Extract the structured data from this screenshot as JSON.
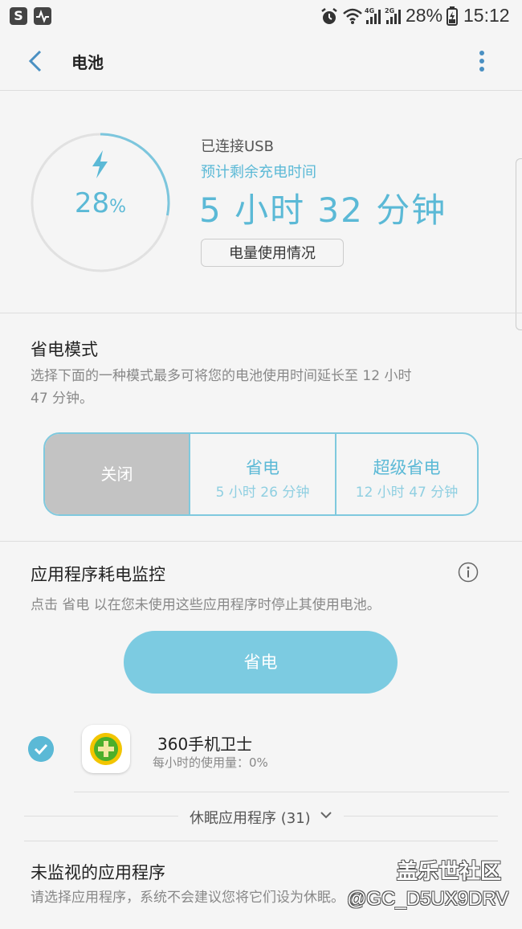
{
  "status_bar": {
    "signal_labels": [
      "4G",
      "2G"
    ],
    "battery": "28%",
    "time": "15:12"
  },
  "appbar": {
    "title": "电池"
  },
  "battery": {
    "percent": "28",
    "percent_unit": "%",
    "charge_level": 0.28,
    "usb_status": "已连接USB",
    "remaining_label": "预计剩余充电时间",
    "remaining_time": "5 小时 32 分钟",
    "usage_button": "电量使用情况"
  },
  "power_saving": {
    "title": "省电模式",
    "description": "选择下面的一种模式最多可将您的电池使用时间延长至 12 小时 47 分钟。",
    "modes": [
      {
        "label": "关闭",
        "sub": ""
      },
      {
        "label": "省电",
        "sub": "5 小时 26 分钟"
      },
      {
        "label": "超级省电",
        "sub": "12 小时 47 分钟"
      }
    ],
    "selected": "关闭"
  },
  "app_monitor": {
    "title": "应用程序耗电监控",
    "description": "点击 省电 以在您未使用这些应用程序时停止其使用电池。",
    "save_button": "省电",
    "apps": [
      {
        "name": "360手机卫士",
        "usage": "每小时的使用量：0%",
        "checked": true
      }
    ],
    "sleeping_apps": "休眠应用程序 (31)"
  },
  "unmonitored": {
    "title": "未监视的应用程序",
    "description": "请选择应用程序，系统不会建议您将它们设为休眠。"
  },
  "watermark": {
    "line1": "盖乐世社区",
    "line2": "@GC_D5UX9DRV"
  },
  "colors": {
    "accent": "#5bb9d6",
    "button": "#7ccbe1",
    "selected_mode": "#c3c3c3"
  }
}
